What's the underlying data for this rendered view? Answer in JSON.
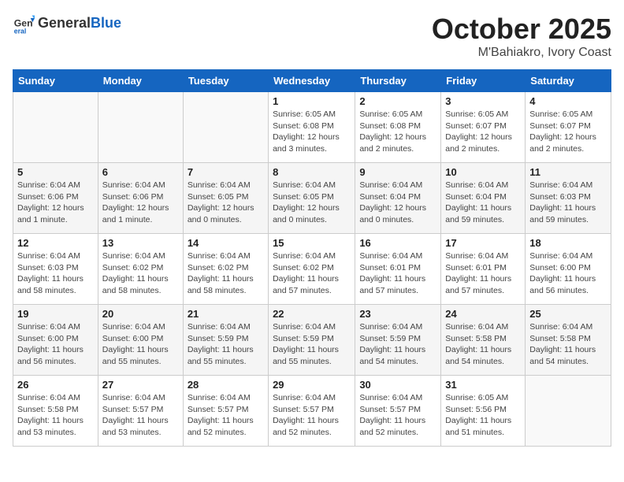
{
  "header": {
    "logo_general": "General",
    "logo_blue": "Blue",
    "month_title": "October 2025",
    "location": "M'Bahiakro, Ivory Coast"
  },
  "weekdays": [
    "Sunday",
    "Monday",
    "Tuesday",
    "Wednesday",
    "Thursday",
    "Friday",
    "Saturday"
  ],
  "weeks": [
    [
      {
        "day": "",
        "info": ""
      },
      {
        "day": "",
        "info": ""
      },
      {
        "day": "",
        "info": ""
      },
      {
        "day": "1",
        "info": "Sunrise: 6:05 AM\nSunset: 6:08 PM\nDaylight: 12 hours and 3 minutes."
      },
      {
        "day": "2",
        "info": "Sunrise: 6:05 AM\nSunset: 6:08 PM\nDaylight: 12 hours and 2 minutes."
      },
      {
        "day": "3",
        "info": "Sunrise: 6:05 AM\nSunset: 6:07 PM\nDaylight: 12 hours and 2 minutes."
      },
      {
        "day": "4",
        "info": "Sunrise: 6:05 AM\nSunset: 6:07 PM\nDaylight: 12 hours and 2 minutes."
      }
    ],
    [
      {
        "day": "5",
        "info": "Sunrise: 6:04 AM\nSunset: 6:06 PM\nDaylight: 12 hours and 1 minute."
      },
      {
        "day": "6",
        "info": "Sunrise: 6:04 AM\nSunset: 6:06 PM\nDaylight: 12 hours and 1 minute."
      },
      {
        "day": "7",
        "info": "Sunrise: 6:04 AM\nSunset: 6:05 PM\nDaylight: 12 hours and 0 minutes."
      },
      {
        "day": "8",
        "info": "Sunrise: 6:04 AM\nSunset: 6:05 PM\nDaylight: 12 hours and 0 minutes."
      },
      {
        "day": "9",
        "info": "Sunrise: 6:04 AM\nSunset: 6:04 PM\nDaylight: 12 hours and 0 minutes."
      },
      {
        "day": "10",
        "info": "Sunrise: 6:04 AM\nSunset: 6:04 PM\nDaylight: 11 hours and 59 minutes."
      },
      {
        "day": "11",
        "info": "Sunrise: 6:04 AM\nSunset: 6:03 PM\nDaylight: 11 hours and 59 minutes."
      }
    ],
    [
      {
        "day": "12",
        "info": "Sunrise: 6:04 AM\nSunset: 6:03 PM\nDaylight: 11 hours and 58 minutes."
      },
      {
        "day": "13",
        "info": "Sunrise: 6:04 AM\nSunset: 6:02 PM\nDaylight: 11 hours and 58 minutes."
      },
      {
        "day": "14",
        "info": "Sunrise: 6:04 AM\nSunset: 6:02 PM\nDaylight: 11 hours and 58 minutes."
      },
      {
        "day": "15",
        "info": "Sunrise: 6:04 AM\nSunset: 6:02 PM\nDaylight: 11 hours and 57 minutes."
      },
      {
        "day": "16",
        "info": "Sunrise: 6:04 AM\nSunset: 6:01 PM\nDaylight: 11 hours and 57 minutes."
      },
      {
        "day": "17",
        "info": "Sunrise: 6:04 AM\nSunset: 6:01 PM\nDaylight: 11 hours and 57 minutes."
      },
      {
        "day": "18",
        "info": "Sunrise: 6:04 AM\nSunset: 6:00 PM\nDaylight: 11 hours and 56 minutes."
      }
    ],
    [
      {
        "day": "19",
        "info": "Sunrise: 6:04 AM\nSunset: 6:00 PM\nDaylight: 11 hours and 56 minutes."
      },
      {
        "day": "20",
        "info": "Sunrise: 6:04 AM\nSunset: 6:00 PM\nDaylight: 11 hours and 55 minutes."
      },
      {
        "day": "21",
        "info": "Sunrise: 6:04 AM\nSunset: 5:59 PM\nDaylight: 11 hours and 55 minutes."
      },
      {
        "day": "22",
        "info": "Sunrise: 6:04 AM\nSunset: 5:59 PM\nDaylight: 11 hours and 55 minutes."
      },
      {
        "day": "23",
        "info": "Sunrise: 6:04 AM\nSunset: 5:59 PM\nDaylight: 11 hours and 54 minutes."
      },
      {
        "day": "24",
        "info": "Sunrise: 6:04 AM\nSunset: 5:58 PM\nDaylight: 11 hours and 54 minutes."
      },
      {
        "day": "25",
        "info": "Sunrise: 6:04 AM\nSunset: 5:58 PM\nDaylight: 11 hours and 54 minutes."
      }
    ],
    [
      {
        "day": "26",
        "info": "Sunrise: 6:04 AM\nSunset: 5:58 PM\nDaylight: 11 hours and 53 minutes."
      },
      {
        "day": "27",
        "info": "Sunrise: 6:04 AM\nSunset: 5:57 PM\nDaylight: 11 hours and 53 minutes."
      },
      {
        "day": "28",
        "info": "Sunrise: 6:04 AM\nSunset: 5:57 PM\nDaylight: 11 hours and 52 minutes."
      },
      {
        "day": "29",
        "info": "Sunrise: 6:04 AM\nSunset: 5:57 PM\nDaylight: 11 hours and 52 minutes."
      },
      {
        "day": "30",
        "info": "Sunrise: 6:04 AM\nSunset: 5:57 PM\nDaylight: 11 hours and 52 minutes."
      },
      {
        "day": "31",
        "info": "Sunrise: 6:05 AM\nSunset: 5:56 PM\nDaylight: 11 hours and 51 minutes."
      },
      {
        "day": "",
        "info": ""
      }
    ]
  ]
}
